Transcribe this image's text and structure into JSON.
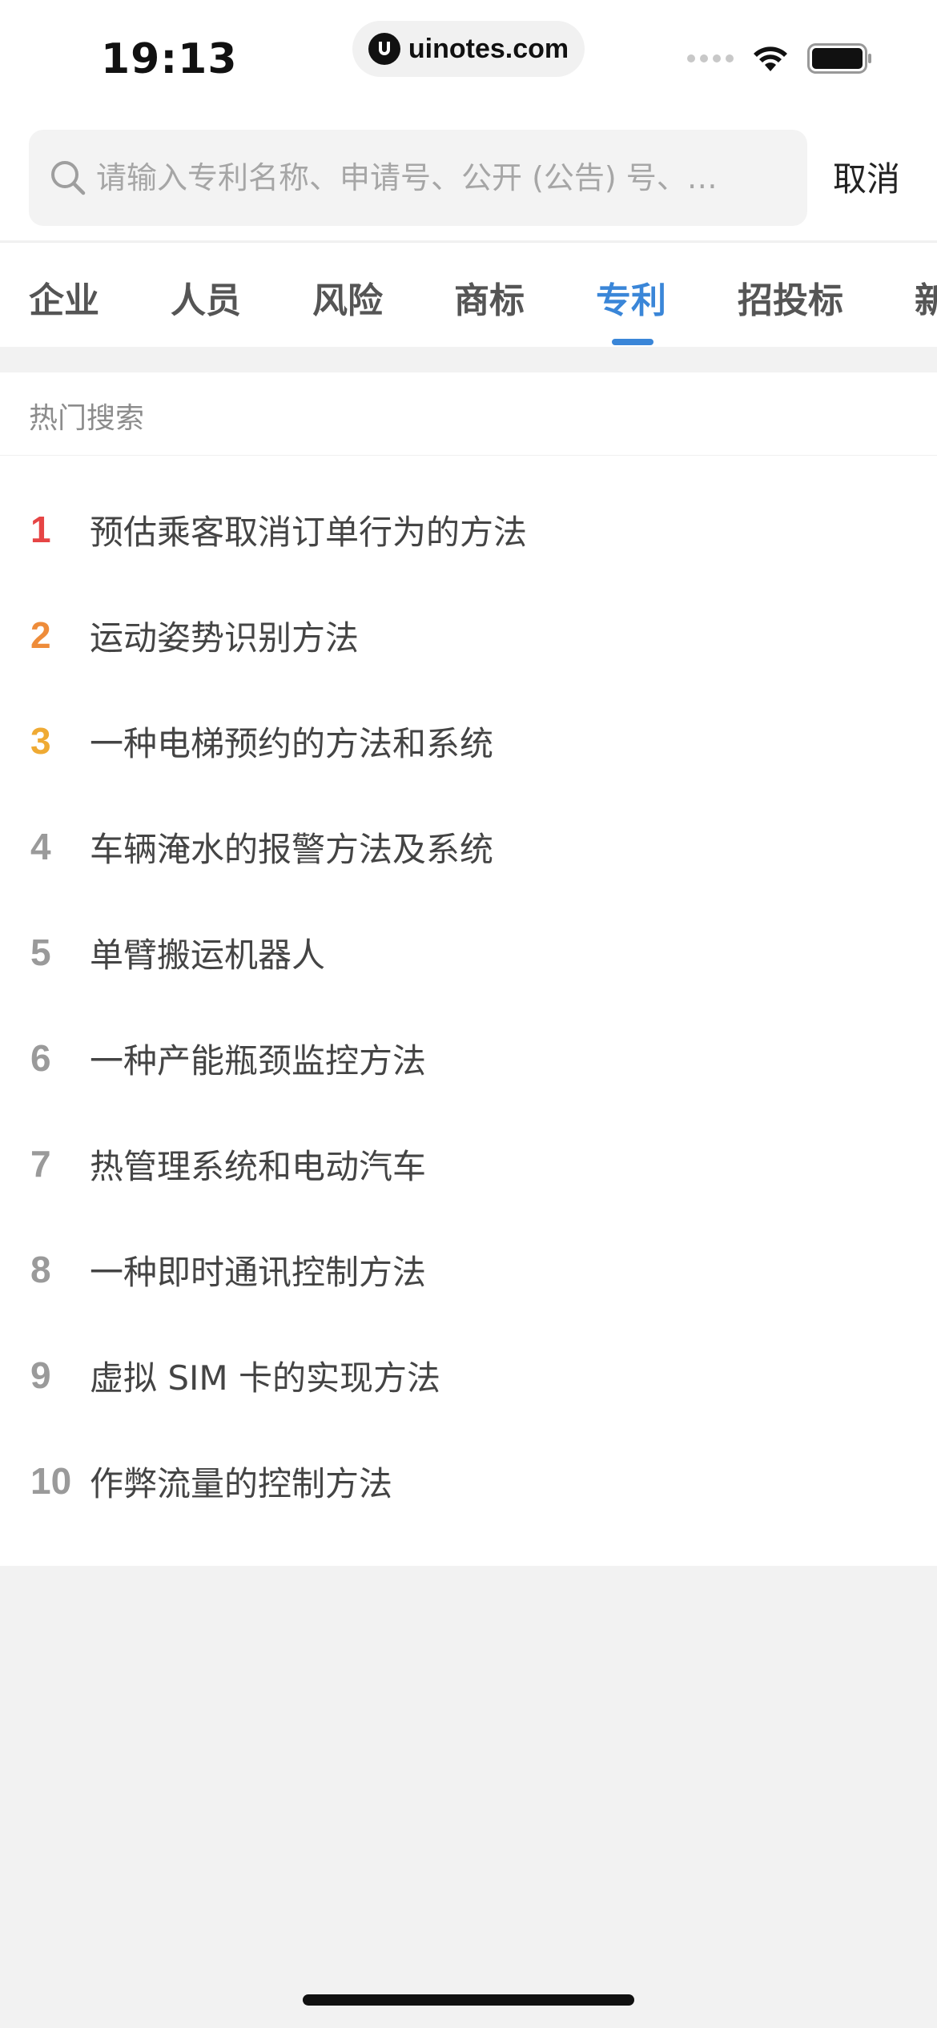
{
  "status_bar": {
    "time": "19:13",
    "url": "uinotes.com",
    "icons": [
      "signal-dots-icon",
      "wifi-icon",
      "battery-icon"
    ]
  },
  "search": {
    "placeholder": "请输入专利名称、申请号、公开 (公告) 号、…",
    "value": "",
    "cancel_label": "取消"
  },
  "tabs": [
    {
      "label": "企业",
      "active": false
    },
    {
      "label": "人员",
      "active": false
    },
    {
      "label": "风险",
      "active": false
    },
    {
      "label": "商标",
      "active": false
    },
    {
      "label": "专利",
      "active": true
    },
    {
      "label": "招投标",
      "active": false
    },
    {
      "label": "新",
      "active": false
    }
  ],
  "hot_search": {
    "title": "热门搜索",
    "items": [
      {
        "rank": "1",
        "text": "预估乘客取消订单行为的方法"
      },
      {
        "rank": "2",
        "text": "运动姿势识别方法"
      },
      {
        "rank": "3",
        "text": "一种电梯预约的方法和系统"
      },
      {
        "rank": "4",
        "text": "车辆淹水的报警方法及系统"
      },
      {
        "rank": "5",
        "text": "单臂搬运机器人"
      },
      {
        "rank": "6",
        "text": "一种产能瓶颈监控方法"
      },
      {
        "rank": "7",
        "text": "热管理系统和电动汽车"
      },
      {
        "rank": "8",
        "text": "一种即时通讯控制方法"
      },
      {
        "rank": "9",
        "text": "虚拟 SIM 卡的实现方法"
      },
      {
        "rank": "10",
        "text": "作弊流量的控制方法"
      }
    ]
  },
  "colors": {
    "accent": "#3a86d8",
    "rank1": "#e64545",
    "rank2": "#ee8c3a",
    "rank3": "#efaa33",
    "rank_default": "#9a9a9a"
  }
}
